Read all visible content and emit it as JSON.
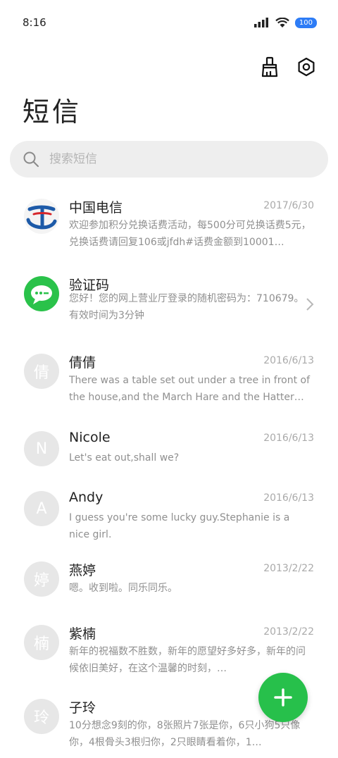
{
  "status_bar": {
    "time": "8:16",
    "battery": "100"
  },
  "header": {
    "title": "短信"
  },
  "search": {
    "placeholder": "搜索短信"
  },
  "messages": [
    {
      "name": "中国电信",
      "date": "2017/6/30",
      "preview": "欢迎参加积分兑换话费活动，每500分可兑换话费5元，兑换话费请回复106或jfdh#话费金额到10001…",
      "avatar": "",
      "avatar_icon": "china-telecom-logo-icon"
    },
    {
      "name": "验证码",
      "date": "",
      "preview": "您好！您的网上营业厅登录的随机密码为：710679。有效时间为3分钟",
      "avatar": "",
      "avatar_icon": "chat-bubble-icon"
    },
    {
      "name": "倩倩",
      "date": "2016/6/13",
      "preview": "There was a table set out under a tree in front of the house,and the March Hare and the Hatter were having tea at it…",
      "avatar": "倩"
    },
    {
      "name": "Nicole",
      "date": "2016/6/13",
      "preview": "Let's eat out,shall we?",
      "avatar": "N"
    },
    {
      "name": "Andy",
      "date": "2016/6/13",
      "preview": "I guess you're some lucky guy.Stephanie is a nice girl.",
      "avatar": "A"
    },
    {
      "name": "燕婷",
      "date": "2013/2/22",
      "preview": "嗯。收到啦。同乐同乐。",
      "avatar": "婷"
    },
    {
      "name": "紫楠",
      "date": "2013/2/22",
      "preview": "新年的祝福数不胜数，新年的愿望好多好多，新年的问候依旧美好，在这个温馨的时刻，…",
      "avatar": "楠"
    },
    {
      "name": "子玲",
      "date": "",
      "preview": "10分想念9刻的你，8张照片7张是你，6只小狗5只像你，4根骨头3根归你，2只眼睛看着你，1…",
      "avatar": "玲"
    }
  ],
  "colors": {
    "accent_green": "#27c04b",
    "battery_blue": "#2d7cf6"
  },
  "icons": {
    "clean": "broom-icon",
    "settings": "hexagon-gear-icon",
    "search": "search-icon",
    "fab": "plus-icon",
    "chevron": "chevron-right-icon"
  }
}
